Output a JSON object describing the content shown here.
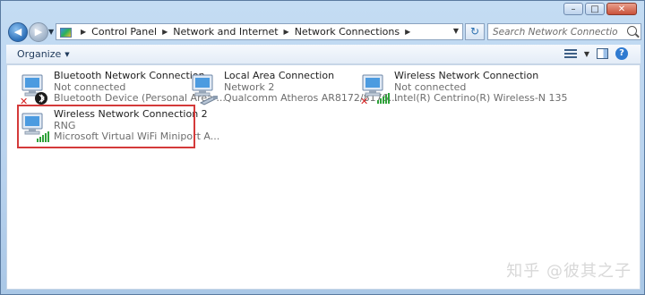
{
  "window": {
    "title_buttons": [
      "–",
      "□",
      "✕"
    ]
  },
  "address": {
    "crumbs": [
      "Control Panel",
      "Network and Internet",
      "Network Connections"
    ]
  },
  "search": {
    "placeholder": "Search Network Connections"
  },
  "toolbar": {
    "organize_label": "Organize"
  },
  "connections": [
    {
      "name": "Bluetooth Network Connection",
      "status": "Not connected",
      "device": "Bluetooth Device (Personal Area ..."
    },
    {
      "name": "Local Area Connection",
      "status": "Network  2",
      "device": "Qualcomm Atheros AR8172/8176..."
    },
    {
      "name": "Wireless Network Connection",
      "status": "Not connected",
      "device": "Intel(R) Centrino(R) Wireless-N 135"
    },
    {
      "name": "Wireless Network Connection 2",
      "status": "RNG",
      "device": "Microsoft Virtual WiFi Miniport A..."
    }
  ],
  "watermark": "知乎 @彼其之子",
  "colors": {
    "highlight": "#d43a3a",
    "accent": "#2f7ad0"
  }
}
